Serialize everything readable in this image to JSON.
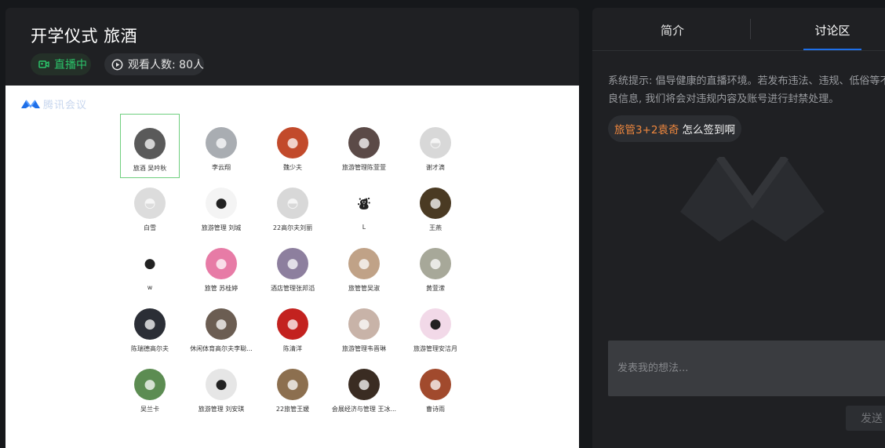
{
  "live": {
    "title": "开学仪式 旅酒",
    "status_label": "直播中",
    "viewers_text": "观看人数: 80人"
  },
  "meeting_logo_text": "腾讯会议",
  "participants": [
    {
      "name": "旅酒 吴吟秋",
      "color": "#5a5a5a",
      "active": true,
      "glyph": "●"
    },
    {
      "name": "李云翔",
      "color": "#a9adb2",
      "glyph": "●"
    },
    {
      "name": "魏少夫",
      "color": "#c24a2b",
      "glyph": "●"
    },
    {
      "name": "旅游管理陈萱萱",
      "color": "#5b4a47",
      "glyph": "●"
    },
    {
      "name": "谢才滴",
      "color": "#d8d8d8",
      "glyph": "◓"
    },
    {
      "name": "白雪",
      "color": "#dcdcdc",
      "glyph": "◓"
    },
    {
      "name": "旅游管理 刘城",
      "color": "#f4f4f4",
      "glyph": "●"
    },
    {
      "name": "22高尔夫刘丽",
      "color": "#d8d8d8",
      "glyph": "◓"
    },
    {
      "name": "L",
      "color": "#ffffff",
      "glyph": "⛇"
    },
    {
      "name": "王燕",
      "color": "#4a3a23",
      "glyph": "●"
    },
    {
      "name": "w",
      "color": "#ffffff",
      "glyph": "●"
    },
    {
      "name": "旅管 苏桂婷",
      "color": "#e77ba6",
      "glyph": "●"
    },
    {
      "name": "酒店管理张邦滔",
      "color": "#8d7f9e",
      "glyph": "●"
    },
    {
      "name": "旅管管吴淑",
      "color": "#c0a287",
      "glyph": "●"
    },
    {
      "name": "黄萱潆",
      "color": "#a7a899",
      "glyph": "●"
    },
    {
      "name": "陈瑞德高尔夫",
      "color": "#2b2e36",
      "glyph": "●"
    },
    {
      "name": "休闲体育高尔夫李聪...",
      "color": "#6b5d52",
      "glyph": "●"
    },
    {
      "name": "陈清洋",
      "color": "#c3221f",
      "glyph": "●"
    },
    {
      "name": "旅游管理韦晋琳",
      "color": "#c8b3a8",
      "glyph": "●"
    },
    {
      "name": "旅游管理安洁月",
      "color": "#f2d9e8",
      "glyph": "●"
    },
    {
      "name": "吴兰卡",
      "color": "#5c8c52",
      "glyph": "●"
    },
    {
      "name": "旅游管理 刘安琪",
      "color": "#e6e6e6",
      "glyph": "●"
    },
    {
      "name": "22旅管王媛",
      "color": "#8c6f4f",
      "glyph": "●"
    },
    {
      "name": "会展经济与管理 王冰...",
      "color": "#3a2c22",
      "glyph": "●"
    },
    {
      "name": "曹诗雨",
      "color": "#a14a2d",
      "glyph": "●"
    }
  ],
  "sidebar": {
    "tabs": [
      {
        "label": "简介"
      },
      {
        "label": "讨论区"
      }
    ],
    "active_tab": 1,
    "system_notice": "系统提示: 倡导健康的直播环境。若发布违法、违规、低俗等不良信息, 我们将会对违规内容及账号进行封禁处理。",
    "messages": [
      {
        "user": "旅管3+2袁奇",
        "text": "怎么签到啊"
      }
    ],
    "comment_placeholder": "发表我的想法...",
    "send_label": "发送"
  },
  "colors": {
    "accent_blue": "#1e6fe8",
    "live_green": "#2bc66b",
    "username_orange": "#f0883e"
  },
  "icons": {
    "live": "video-camera-icon",
    "viewers": "eye-icon",
    "logo": "tencent-meeting-logo"
  }
}
